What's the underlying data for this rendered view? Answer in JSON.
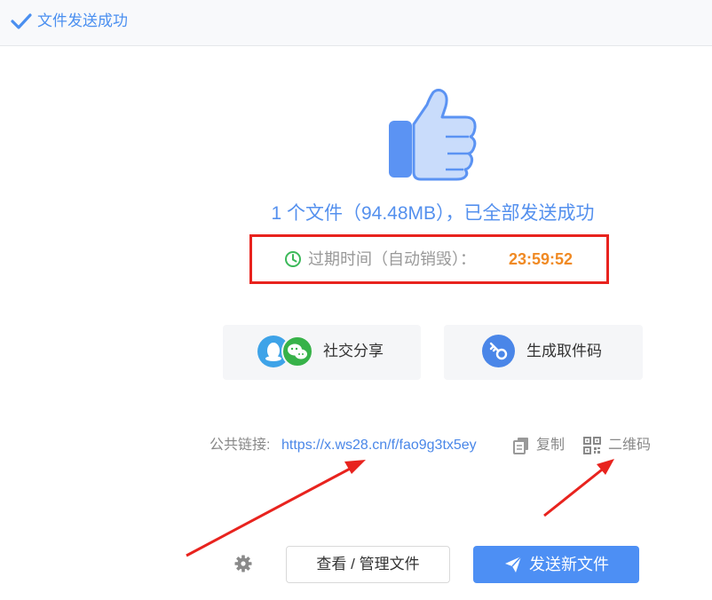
{
  "header": {
    "title": "文件发送成功",
    "icon": "check-icon"
  },
  "summary": {
    "headline": "1 个文件（94.48MB），已全部发送成功",
    "file_count": 1,
    "total_size": "94.48MB"
  },
  "expiry": {
    "label": "过期时间（自动销毁）：",
    "countdown": "23:59:52",
    "icon": "clock-icon"
  },
  "actions": {
    "social_share_label": "社交分享",
    "pickup_code_label": "生成取件码"
  },
  "link": {
    "label": "公共链接:",
    "url": "https://x.ws28.cn/f/fao9g3tx5ey",
    "copy_label": "复制",
    "qrcode_label": "二维码"
  },
  "footer": {
    "manage_label": "查看 / 管理文件",
    "send_new_label": "发送新文件"
  },
  "colors": {
    "accent": "#4d8ff4",
    "countdown": "#f08a24",
    "highlight_box": "#e8231e",
    "annotation_arrow": "#e8231e"
  }
}
